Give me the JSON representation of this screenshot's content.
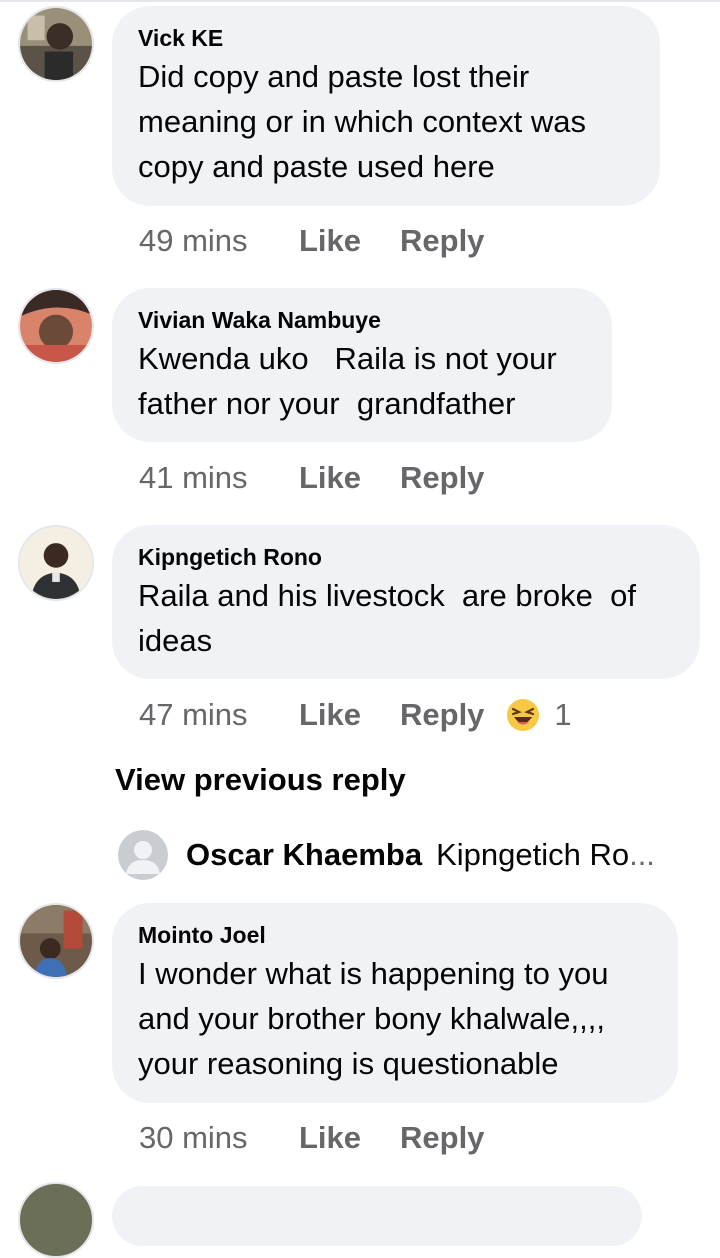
{
  "comments": [
    {
      "author": "Vick KE",
      "text": "Did copy and paste lost their\nmeaning or in which context was\ncopy and paste used here",
      "time": "49 mins",
      "like_label": "Like",
      "reply_label": "Reply"
    },
    {
      "author": "Vivian Waka Nambuye",
      "text": "Kwenda uko   Raila is not your\nfather nor your  grandfather",
      "time": "41 mins",
      "like_label": "Like",
      "reply_label": "Reply"
    },
    {
      "author": "Kipngetich Rono",
      "text": "Raila and his livestock  are broke  of\nideas",
      "time": "47 mins",
      "like_label": "Like",
      "reply_label": "Reply",
      "reaction_icon": "laughing-emoji",
      "reaction_count": "1"
    },
    {
      "author": "Mointo Joel",
      "text": "I wonder what is happening to you\nand your brother bony khalwale,,,,\nyour reasoning is questionable",
      "time": "30 mins",
      "like_label": "Like",
      "reply_label": "Reply"
    }
  ],
  "view_previous": "View previous reply",
  "reply_preview": {
    "name": "Oscar Khaemba",
    "snippet": "Kipngetich Ro",
    "ellipsis": "..."
  },
  "colors": {
    "bubble": "#f0f2f5",
    "meta_text": "#65676b",
    "primary_text": "#050505"
  }
}
